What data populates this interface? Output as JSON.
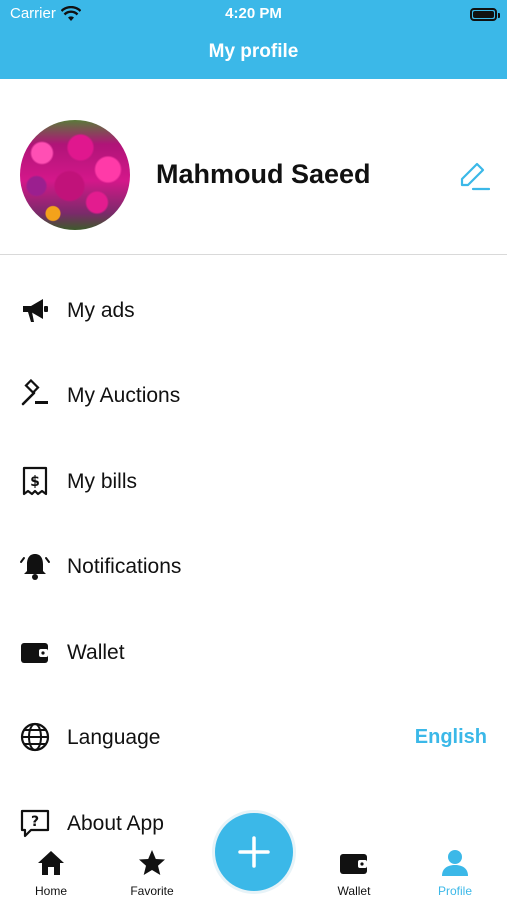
{
  "status": {
    "carrier": "Carrier",
    "time": "4:20 PM"
  },
  "header": {
    "title": "My profile"
  },
  "profile": {
    "name": "Mahmoud Saeed"
  },
  "menu": [
    {
      "label": "My ads",
      "icon": "megaphone-icon"
    },
    {
      "label": "My Auctions",
      "icon": "gavel-icon"
    },
    {
      "label": "My bills",
      "icon": "bill-icon"
    },
    {
      "label": "Notifications",
      "icon": "bell-icon"
    },
    {
      "label": "Wallet",
      "icon": "wallet-icon"
    },
    {
      "label": "Language",
      "icon": "globe-icon",
      "value": "English"
    },
    {
      "label": "About App",
      "icon": "question-icon"
    }
  ],
  "tabs": [
    {
      "label": "Home",
      "icon": "home-icon"
    },
    {
      "label": "Favorite",
      "icon": "star-icon"
    },
    {
      "label": "Wallet",
      "icon": "wallet-icon"
    },
    {
      "label": "Profile",
      "icon": "user-icon",
      "active": true
    }
  ],
  "colors": {
    "accent": "#3bb8e8",
    "text": "#111111",
    "divider": "#d9d9d9"
  }
}
